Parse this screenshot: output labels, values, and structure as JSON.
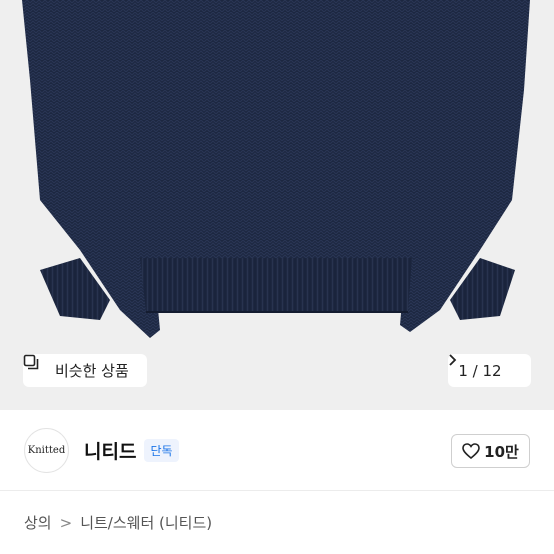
{
  "image": {
    "sweater_color": "#1c2740",
    "background_color": "#efefef"
  },
  "overlay": {
    "similar_label": "비슷한 상품",
    "similar_icon": "copy-icon",
    "pager_text": "1 / 12",
    "pager_icon": "chevron-right-icon"
  },
  "shop": {
    "logo_text": "Knitted",
    "name": "니티드",
    "badge": "단독",
    "badge_color": "#1a73e8",
    "like_count": "10만",
    "like_icon": "heart-outline-icon"
  },
  "breadcrumb": {
    "items": [
      "상의",
      "니트/스웨터 (니티드)"
    ]
  }
}
